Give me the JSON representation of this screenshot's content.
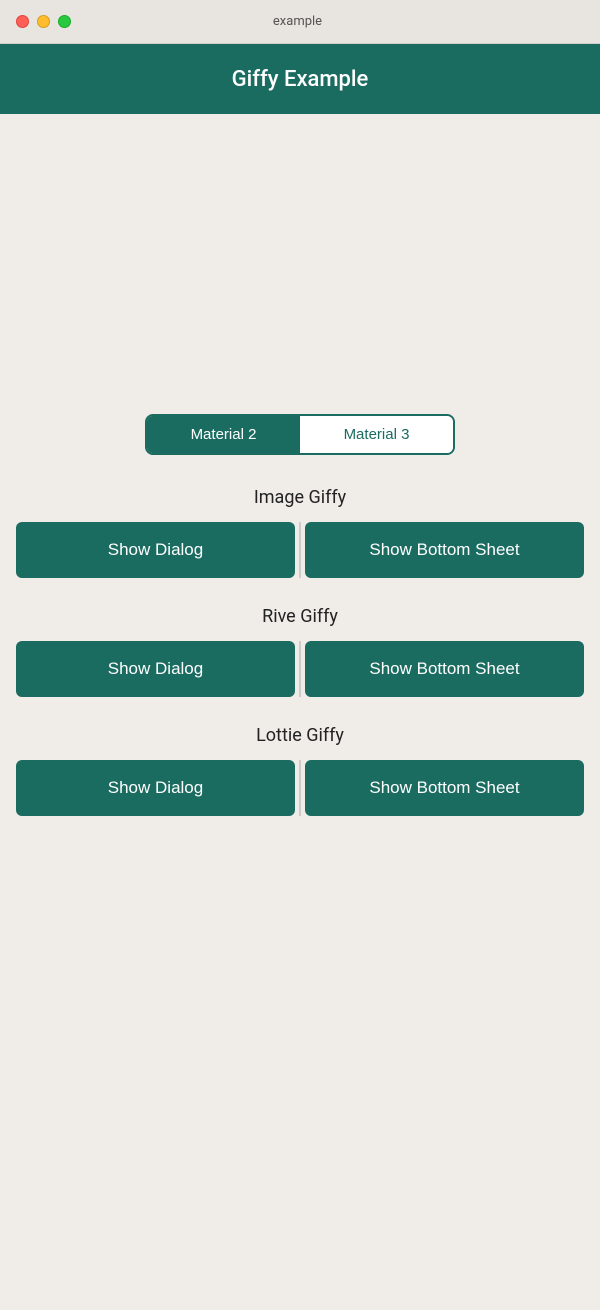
{
  "window": {
    "title": "example"
  },
  "header": {
    "title": "Giffy Example",
    "bg_color": "#1a6b60"
  },
  "tabs": [
    {
      "id": "material2",
      "label": "Material 2",
      "active": true
    },
    {
      "id": "material3",
      "label": "Material 3",
      "active": false
    }
  ],
  "sections": [
    {
      "id": "image-giffy",
      "title": "Image Giffy",
      "dialog_label": "Show Dialog",
      "sheet_label": "Show Bottom Sheet"
    },
    {
      "id": "rive-giffy",
      "title": "Rive Giffy",
      "dialog_label": "Show Dialog",
      "sheet_label": "Show Bottom Sheet"
    },
    {
      "id": "lottie-giffy",
      "title": "Lottie Giffy",
      "dialog_label": "Show Dialog",
      "sheet_label": "Show Bottom Sheet"
    }
  ],
  "colors": {
    "teal": "#1a6b60",
    "teal_hover": "#155a50",
    "bg": "#f0ede8",
    "white": "#ffffff"
  }
}
